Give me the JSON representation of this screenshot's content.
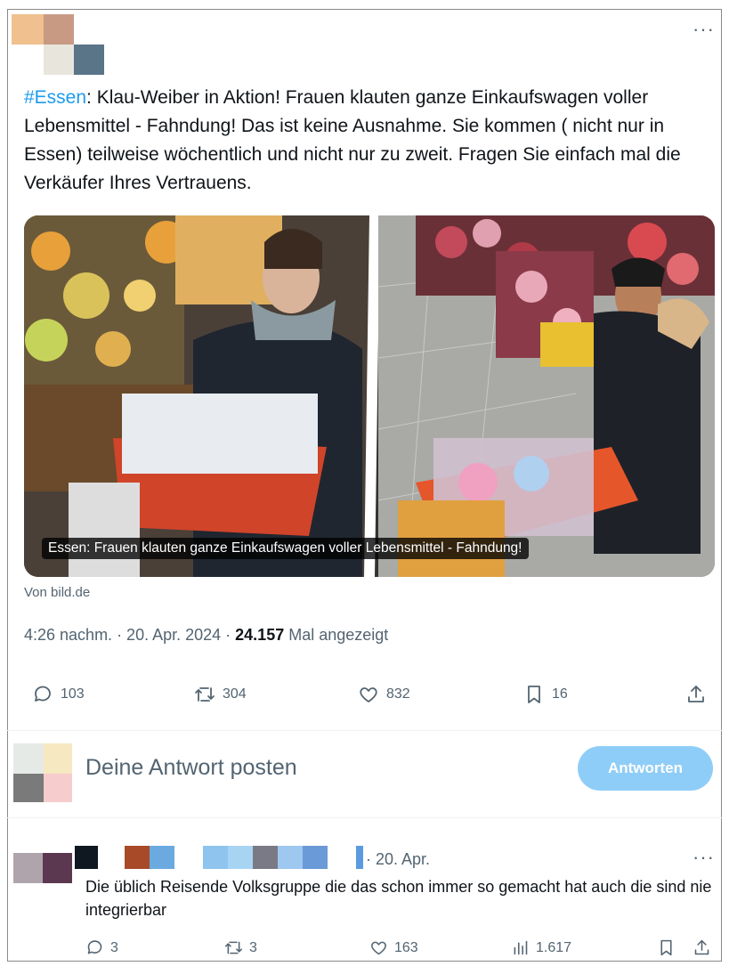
{
  "tweet": {
    "hashtag": "#Essen",
    "text": ": Klau-Weiber in Aktion! Frauen klauten ganze Einkaufswagen voller Lebensmittel - Fahndung! Das ist keine Ausnahme. Sie kommen ( nicht nur in Essen) teilweise wöchentlich und nicht nur zu zweit. Fragen Sie einfach mal die Verkäufer Ihres Vertrauens.",
    "media_caption": "Essen: Frauen klauten ganze Einkaufswagen voller Lebensmittel - Fahndung!",
    "source": "Von bild.de",
    "timestamp": "4:26 nachm. · 20. Apr. 2024 · ",
    "views_count": "24.157",
    "views_label": " Mal angezeigt",
    "more_icon": "more-icon",
    "stats": {
      "replies": "103",
      "reposts": "304",
      "likes": "832",
      "bookmarks": "16"
    }
  },
  "compose": {
    "placeholder": "Deine Antwort posten",
    "button_label": "Antworten",
    "button_color": "#8ecdf7"
  },
  "reply": {
    "date": "· 20. Apr.",
    "text": "Die üblich Reisende Volksgruppe die das schon immer so gemacht hat auch die sind nie integrierbar",
    "stats": {
      "replies": "3",
      "reposts": "3",
      "likes": "163",
      "views": "1.617"
    }
  },
  "colors": {
    "accent": "#1d9bf0",
    "muted": "#536471",
    "text": "#0f1419"
  }
}
